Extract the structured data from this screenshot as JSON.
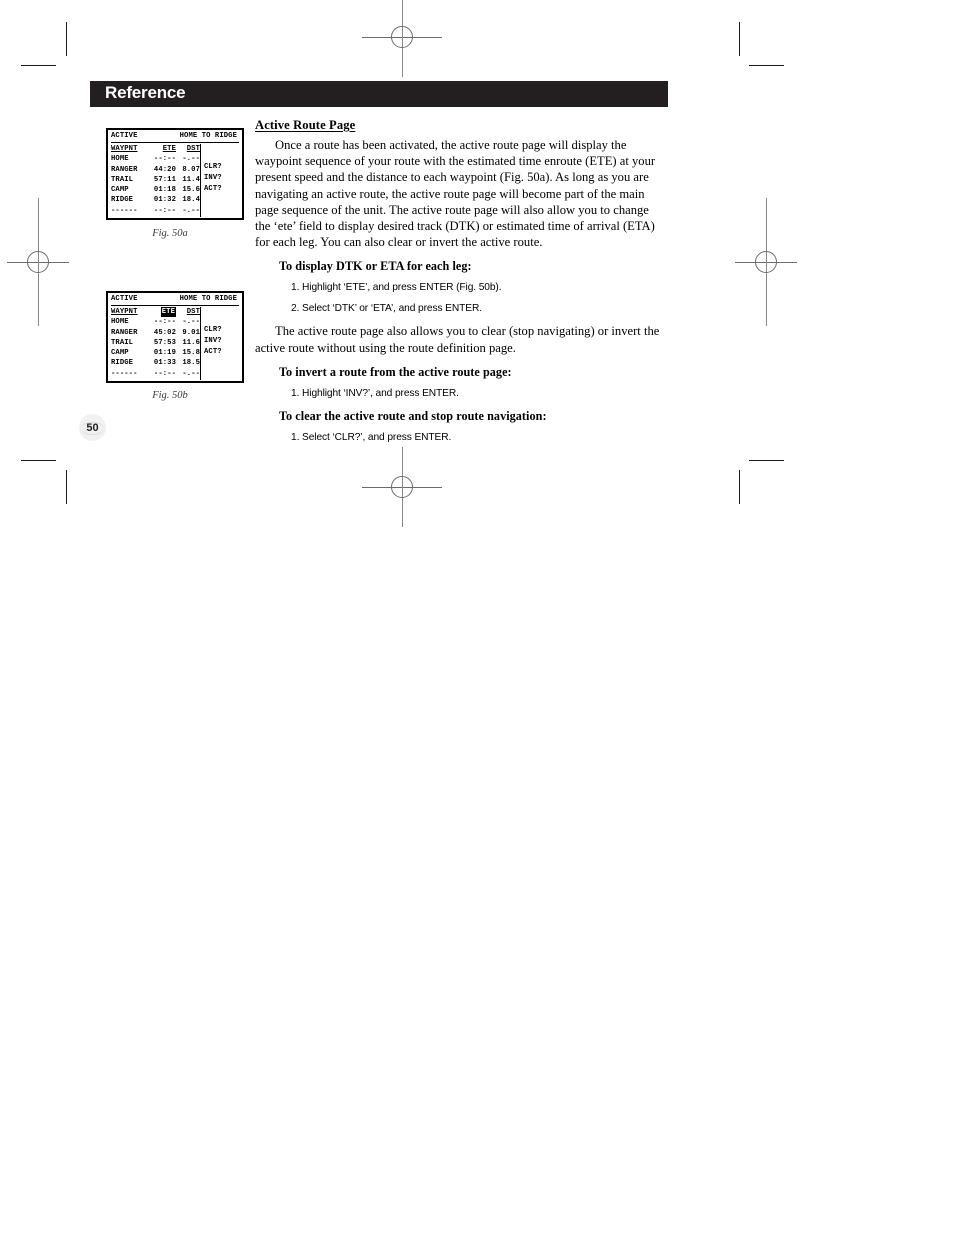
{
  "header": {
    "title": "Reference"
  },
  "page_number": "50",
  "figures": [
    {
      "name": "fig-50a",
      "caption": "Fig. 50a",
      "screen": {
        "title_left": "ACTIVE",
        "title_right": "HOME TO RIDGE",
        "columns": [
          "WAYPNT",
          "ETE",
          "DST"
        ],
        "highlighted_column": "",
        "rows": [
          {
            "wpt": "HOME",
            "ete": "--:--",
            "dst": "-.--"
          },
          {
            "wpt": "RANGER",
            "ete": "44:20",
            "dst": "8.07"
          },
          {
            "wpt": "TRAIL",
            "ete": "57:11",
            "dst": "11.4"
          },
          {
            "wpt": "CAMP",
            "ete": "01:18",
            "dst": "15.6"
          },
          {
            "wpt": "RIDGE",
            "ete": "01:32",
            "dst": "18.4"
          }
        ],
        "footer_row": {
          "wpt": "------",
          "ete": "--:--",
          "dst": "-.--"
        },
        "buttons": [
          "CLR?",
          "INV?",
          "ACT?"
        ]
      }
    },
    {
      "name": "fig-50b",
      "caption": "Fig. 50b",
      "screen": {
        "title_left": "ACTIVE",
        "title_right": "HOME TO RIDGE",
        "columns": [
          "WAYPNT",
          "ETE",
          "DST"
        ],
        "highlighted_column": "ETE",
        "rows": [
          {
            "wpt": "HOME",
            "ete": "--:--",
            "dst": "-.--"
          },
          {
            "wpt": "RANGER",
            "ete": "45:02",
            "dst": "9.01"
          },
          {
            "wpt": "TRAIL",
            "ete": "57:53",
            "dst": "11.6"
          },
          {
            "wpt": "CAMP",
            "ete": "01:19",
            "dst": "15.8"
          },
          {
            "wpt": "RIDGE",
            "ete": "01:33",
            "dst": "18.5"
          }
        ],
        "footer_row": {
          "wpt": "------",
          "ete": "--:--",
          "dst": "-.--"
        },
        "buttons": [
          "CLR?",
          "INV?",
          "ACT?"
        ]
      }
    }
  ],
  "content": {
    "section_title": "Active Route Page",
    "intro_paragraph": "Once a route has been activated, the active route page will display the waypoint sequence of your route with the estimated time enroute (ETE) at your present speed and the distance to each waypoint (Fig. 50a). As long as you are navigating an active route, the active route page will become part of the main page sequence of the unit. The active route page will also allow you to change the ‘ete’ field to display desired track (DTK) or estimated time of arrival (ETA) for each leg. You can also clear or invert the active route.",
    "proc1_heading": "To display DTK or ETA for each leg:",
    "proc1_step1": "1. Highlight ‘ETE’, and press ENTER (Fig. 50b).",
    "proc1_step2": "2. Select ‘DTK’ or ‘ETA’, and press ENTER.",
    "mid_paragraph": "The active route page also allows you to clear (stop navigating) or invert the active route without using the route definition page.",
    "proc2_heading": "To invert a route from the active route page:",
    "proc2_step1": "1. Highlight ‘INV?’, and press ENTER.",
    "proc3_heading": "To clear the active route and stop route navigation:",
    "proc3_step1": "1. Select ‘CLR?’, and press ENTER."
  }
}
